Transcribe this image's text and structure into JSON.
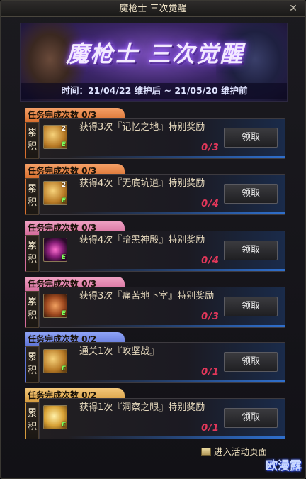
{
  "window": {
    "title": "魔枪士 三次觉醒",
    "close_glyph": "✕"
  },
  "banner": {
    "title": "魔枪士 三次觉醒",
    "period": "时间：21/04/22 维护后 ~ 21/05/20 维护前"
  },
  "claim_label": "领取",
  "side_label": {
    "top": "累",
    "bottom": "积"
  },
  "tasks": [
    {
      "tab": "任务完成次数 0/3",
      "color": "orange",
      "icon": "treasure-box-icon",
      "badge": "2",
      "desc": "获得3次『记忆之地』特别奖励",
      "progress": "0/3"
    },
    {
      "tab": "任务完成次数 0/3",
      "color": "orange",
      "icon": "treasure-box-icon",
      "badge": "2",
      "desc": "获得4次『无底坑道』特别奖励",
      "progress": "0/4"
    },
    {
      "tab": "任务完成次数 0/3",
      "color": "pink",
      "icon": "dark-orb-icon",
      "badge": "",
      "desc": "获得4次『暗黑神殿』特别奖励",
      "progress": "0/4"
    },
    {
      "tab": "任务完成次数 0/3",
      "color": "pink",
      "icon": "chest-icon",
      "badge": "",
      "desc": "获得3次『痛苦地下室』特别奖励",
      "progress": "0/3"
    },
    {
      "tab": "任务完成次数 0/2",
      "color": "blue",
      "icon": "battle-icon",
      "badge": "",
      "desc": "通关1次『攻坚战』",
      "progress": "0/1"
    },
    {
      "tab": "任务完成次数 0/2",
      "color": "yellow",
      "icon": "gold-box-icon",
      "badge": "",
      "desc": "获得1次『洞察之眼』特别奖励",
      "progress": "0/1"
    }
  ],
  "footer": {
    "link": "进入活动页面"
  },
  "watermark": "欧漫露",
  "colors": {
    "orange": "#d86f2e",
    "pink": "#d56d9c",
    "blue": "#5e74d6",
    "yellow": "#d59a3d",
    "progress": "#e2375a"
  }
}
